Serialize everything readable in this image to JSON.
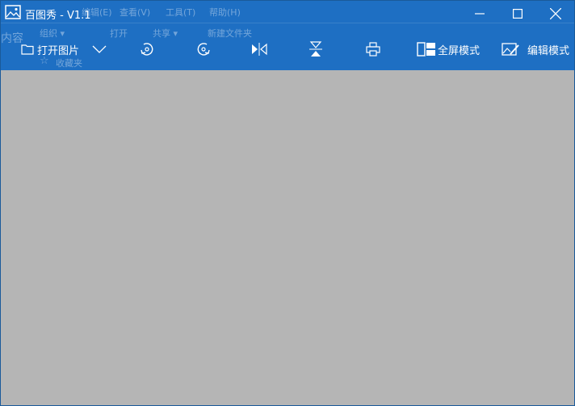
{
  "window": {
    "title": "百图秀 - V1.1",
    "accent_color": "#1e6fc3",
    "canvas_color": "#b5b5b5"
  },
  "window_controls": {
    "minimize_icon": "minimize-icon",
    "maximize_icon": "maximize-icon",
    "close_icon": "close-icon"
  },
  "ghost": {
    "menu_edit": "编辑(E)",
    "menu_view": "查看(V)",
    "menu_tools": "工具(T)",
    "menu_help": "帮助(H)",
    "organize": "组织 ▾",
    "open": "打开",
    "share": "共享 ▾",
    "new_folder": "新建文件夹",
    "favorites": "收藏夹",
    "content": "内容"
  },
  "toolbar": {
    "open_image_label": "打开图片",
    "fullscreen_label": "全屏模式",
    "edit_mode_label": "编辑模式"
  }
}
